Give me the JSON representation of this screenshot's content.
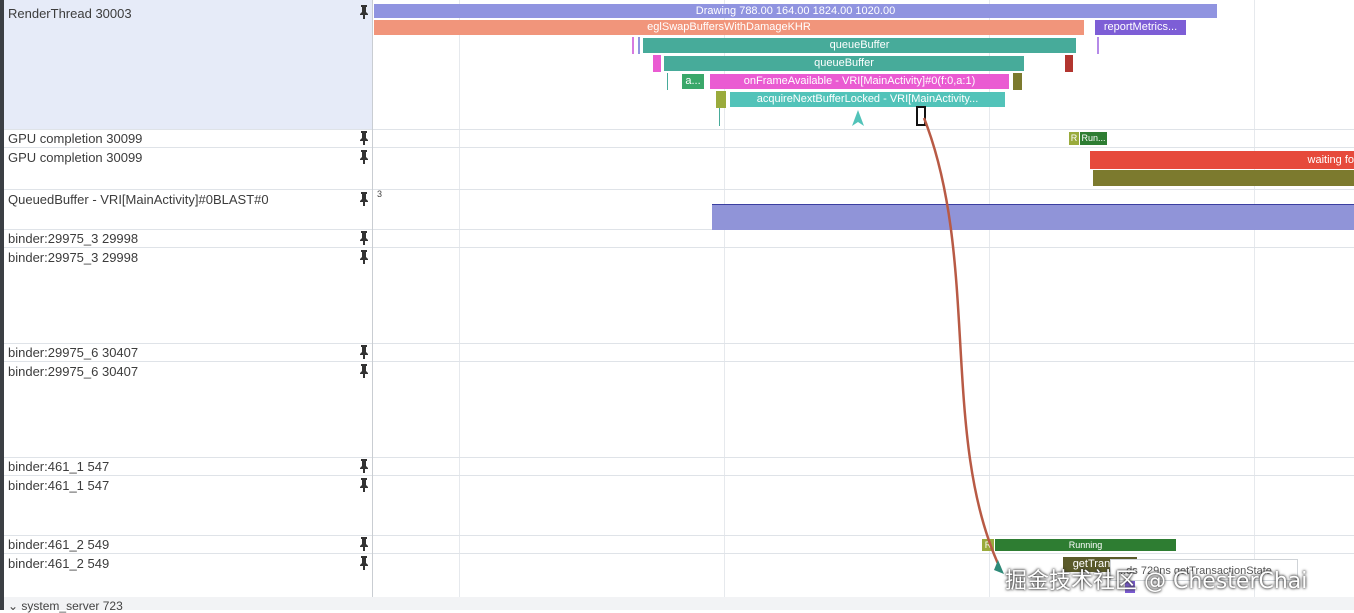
{
  "tracks": [
    {
      "label": "RenderThread 30003"
    },
    {
      "label": "GPU completion 30099"
    },
    {
      "label": "GPU completion 30099"
    },
    {
      "label": "QueuedBuffer - VRI[MainActivity]#0BLAST#0",
      "value_text": "3"
    },
    {
      "label": "binder:29975_3 29998"
    },
    {
      "label": "binder:29975_3 29998"
    },
    {
      "label": "binder:29975_6 30407"
    },
    {
      "label": "binder:29975_6 30407"
    },
    {
      "label": "binder:461_1 547"
    },
    {
      "label": "binder:461_1 547"
    },
    {
      "label": "binder:461_2 549"
    },
    {
      "label": "binder:461_2 549"
    },
    {
      "label": "system_server 723"
    }
  ],
  "slices": {
    "drawing": "Drawing 788.00 164.00 1824.00 1020.00",
    "egl_swap": "eglSwapBuffersWithDamageKHR",
    "report_metrics": "reportMetrics...",
    "queue_buffer_1": "queueBuffer",
    "queue_buffer_2": "queueBuffer",
    "a_short": "a...",
    "on_frame_available": "onFrameAvailable - VRI[MainActivity]#0(f:0,a:1)",
    "acquire_next": "acquireNextBufferLocked - VRI[MainActivity...",
    "gpu_r": "R",
    "gpu_running": "Run...",
    "waiting": "waiting fo",
    "binder_r": "R",
    "binder_running": "Running",
    "get_transact": "getTransac"
  },
  "tooltip": "...ds 729ns getTransactionState",
  "watermark": "掘金技术社区 @ ChesterChai",
  "colors": {
    "label_highlight": "#e6ebf8",
    "drawing": "#9094e0",
    "egl": "#f1957b",
    "report": "#7d5ed6",
    "queue": "#47ab9a",
    "onframe": "#ea5bd2",
    "acquire": "#52c3b9",
    "running": "#2e7d32",
    "runnable": "#9aab3c",
    "waiting": "#e64a3b",
    "olive": "#7c7a2e",
    "queued_buffer": "#9094d8",
    "flow_arrow": "#b85a45"
  }
}
